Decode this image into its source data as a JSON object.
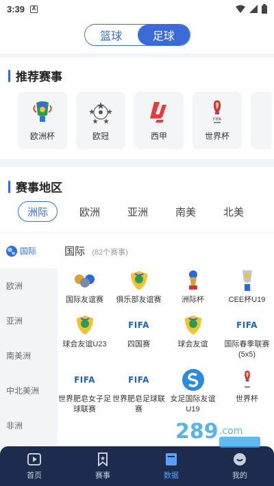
{
  "status_bar": {
    "time": "3:39",
    "notif_glyph": "A"
  },
  "sport_toggle": {
    "options": [
      "篮球",
      "足球"
    ],
    "selected": "足球"
  },
  "recommended": {
    "title": "推荐赛事",
    "items": [
      {
        "label": "欧洲杯",
        "icon": "euro-cup-logo"
      },
      {
        "label": "欧冠",
        "icon": "champions-league-logo"
      },
      {
        "label": "西甲",
        "icon": "laliga-logo"
      },
      {
        "label": "世界杯",
        "icon": "world-cup-logo"
      }
    ]
  },
  "region": {
    "title": "赛事地区",
    "tabs": [
      "洲际",
      "欧洲",
      "亚洲",
      "南美",
      "北美"
    ],
    "active_tab": "洲际",
    "sidebar": [
      "国际",
      "欧洲",
      "亚洲",
      "南美洲",
      "中北美洲",
      "非洲"
    ],
    "selected_sidebar": "国际",
    "content_title": "国际",
    "content_count": "(82个赛事)",
    "competitions": [
      {
        "label": "国际友谊赛",
        "icon": "balls-icon"
      },
      {
        "label": "俱乐部友谊赛",
        "icon": "club-friendly-icon"
      },
      {
        "label": "洲际杯",
        "icon": "intercontinental-cup-icon"
      },
      {
        "label": "CEE杯U19",
        "icon": "cee-cup-icon"
      },
      {
        "label": "球会友谊U23",
        "icon": "club-friendly-icon"
      },
      {
        "label": "四国赛",
        "icon": "fifa-logo",
        "logo_text": "FIFA"
      },
      {
        "label": "球会友谊",
        "icon": "club-friendly-icon"
      },
      {
        "label": "国际春季联赛(5x5)",
        "icon": "fifa-logo",
        "logo_text": "FIFA"
      },
      {
        "label": "世界肥皂女子足球联赛",
        "icon": "fifa-logo",
        "logo_text": "FIFA"
      },
      {
        "label": "世界肥皂足球联赛",
        "icon": "fifa-logo",
        "logo_text": "FIFA"
      },
      {
        "label": "女足国际友谊U19",
        "icon": "s-logo"
      },
      {
        "label": "世界杯",
        "icon": "world-cup-logo"
      }
    ]
  },
  "bottom_nav": {
    "items": [
      {
        "label": "首页",
        "icon": "play-icon"
      },
      {
        "label": "赛事",
        "icon": "bookmark-icon"
      },
      {
        "label": "数据",
        "icon": "book-icon"
      },
      {
        "label": "我的",
        "icon": "user-icon"
      }
    ],
    "active": "数据"
  },
  "colors": {
    "accent": "#3a6ad8",
    "nav_bg": "#1c2b4e",
    "nav_active": "#5aa0ff"
  }
}
